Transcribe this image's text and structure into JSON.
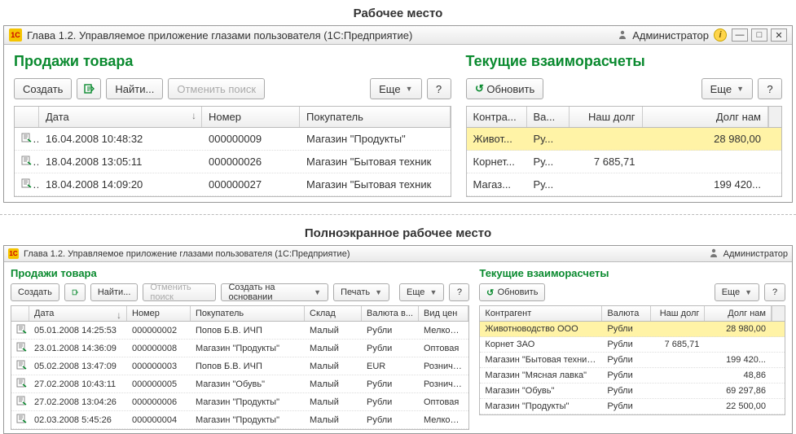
{
  "captions": {
    "top": "Рабочее место",
    "bottom": "Полноэкранное рабочее место"
  },
  "titlebar": {
    "title": "Глава 1.2. Управляемое приложение глазами пользователя  (1С:Предприятие)",
    "user": "Администратор"
  },
  "sales": {
    "title": "Продажи товара",
    "buttons": {
      "create": "Создать",
      "find": "Найти...",
      "cancel_search": "Отменить поиск",
      "more": "Еще",
      "help": "?",
      "create_based": "Создать на основании",
      "print": "Печать"
    },
    "headers": {
      "date": "Дата",
      "number": "Номер",
      "buyer": "Покупатель",
      "warehouse": "Склад",
      "currency": "Валюта в...",
      "price_type": "Вид цен"
    },
    "rows_top": [
      {
        "date": "16.04.2008 10:48:32",
        "number": "000000009",
        "buyer": "Магазин \"Продукты\""
      },
      {
        "date": "18.04.2008 13:05:11",
        "number": "000000026",
        "buyer": "Магазин \"Бытовая техник"
      },
      {
        "date": "18.04.2008 14:09:20",
        "number": "000000027",
        "buyer": "Магазин \"Бытовая техник"
      }
    ],
    "rows_full": [
      {
        "date": "05.01.2008 14:25:53",
        "number": "000000002",
        "buyer": "Попов Б.В. ИЧП",
        "warehouse": "Малый",
        "currency": "Рубли",
        "price_type": "Мелкоопт"
      },
      {
        "date": "23.01.2008 14:36:09",
        "number": "000000008",
        "buyer": "Магазин \"Продукты\"",
        "warehouse": "Малый",
        "currency": "Рубли",
        "price_type": "Оптовая"
      },
      {
        "date": "05.02.2008 13:47:09",
        "number": "000000003",
        "buyer": "Попов Б.В. ИЧП",
        "warehouse": "Малый",
        "currency": "EUR",
        "price_type": "Розничная"
      },
      {
        "date": "27.02.2008 10:43:11",
        "number": "000000005",
        "buyer": "Магазин \"Обувь\"",
        "warehouse": "Малый",
        "currency": "Рубли",
        "price_type": "Розничная"
      },
      {
        "date": "27.02.2008 13:04:26",
        "number": "000000006",
        "buyer": "Магазин \"Продукты\"",
        "warehouse": "Малый",
        "currency": "Рубли",
        "price_type": "Оптовая"
      },
      {
        "date": "02.03.2008 5:45:26",
        "number": "000000004",
        "buyer": "Магазин \"Продукты\"",
        "warehouse": "Малый",
        "currency": "Рубли",
        "price_type": "Мелкоопт"
      }
    ]
  },
  "settlements": {
    "title": "Текущие взаиморасчеты",
    "buttons": {
      "refresh": "Обновить",
      "more": "Еще",
      "help": "?"
    },
    "headers": {
      "counterparty": "Контра...",
      "currency": "Ва...",
      "our_debt": "Наш долг",
      "debt_to_us": "Долг нам",
      "counterparty_full": "Контрагент",
      "currency_full": "Валюта"
    },
    "rows_top": [
      {
        "cp": "Живот...",
        "cur": "Ру...",
        "our": "",
        "to_us": "28 980,00",
        "hl": true
      },
      {
        "cp": "Корнет...",
        "cur": "Ру...",
        "our": "7 685,71",
        "to_us": ""
      },
      {
        "cp": "Магаз...",
        "cur": "Ру...",
        "our": "",
        "to_us": "199 420..."
      }
    ],
    "rows_full": [
      {
        "cp": "Животноводство ООО",
        "cur": "Рубли",
        "our": "",
        "to_us": "28 980,00",
        "hl": true
      },
      {
        "cp": "Корнет ЗАО",
        "cur": "Рубли",
        "our": "7 685,71",
        "to_us": ""
      },
      {
        "cp": "Магазин \"Бытовая техника\"",
        "cur": "Рубли",
        "our": "",
        "to_us": "199 420..."
      },
      {
        "cp": "Магазин \"Мясная лавка\"",
        "cur": "Рубли",
        "our": "",
        "to_us": "48,86"
      },
      {
        "cp": "Магазин \"Обувь\"",
        "cur": "Рубли",
        "our": "",
        "to_us": "69 297,86"
      },
      {
        "cp": "Магазин \"Продукты\"",
        "cur": "Рубли",
        "our": "",
        "to_us": "22 500,00"
      }
    ]
  }
}
